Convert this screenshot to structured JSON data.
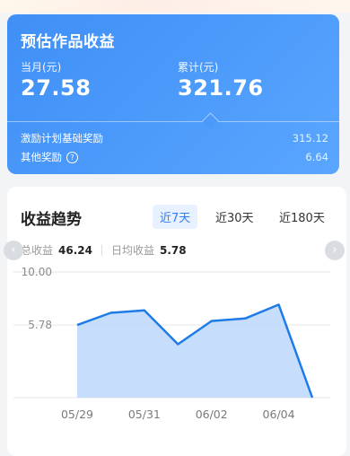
{
  "earnings_card": {
    "title": "预估作品收益",
    "current_month_label": "当月(元)",
    "current_month_value": "27.58",
    "cumulative_label": "累计(元)",
    "cumulative_value": "321.76",
    "rows": [
      {
        "label": "激励计划基础奖励",
        "value": "315.12"
      },
      {
        "label": "其他奖励",
        "value": "6.64",
        "help_icon": "?"
      }
    ]
  },
  "trend_card": {
    "title": "收益趋势",
    "tabs": [
      "近7天",
      "近30天",
      "近180天"
    ],
    "active_tab": 0,
    "total_label": "总收益",
    "total_value": "46.24",
    "daily_avg_label": "日均收益",
    "daily_avg_value": "5.78",
    "prev_icon": "chevron-left-icon",
    "next_icon": "chevron-right-icon"
  },
  "chart_data": {
    "type": "area",
    "x": [
      "05/29",
      "05/30",
      "05/31",
      "06/01",
      "06/02",
      "06/03",
      "06/04",
      "06/05"
    ],
    "xtick_labels": [
      "05/29",
      "05/31",
      "06/02",
      "06/04"
    ],
    "series": [
      {
        "values": [
          5.78,
          6.75,
          6.95,
          4.25,
          6.1,
          6.3,
          7.4,
          0.0
        ]
      }
    ],
    "ytick_labels": [
      "10.00",
      "5.78"
    ],
    "ylim": [
      0,
      10
    ],
    "grid": true,
    "colors": {
      "line": "#1f7be8",
      "fill": "#bcd8fb"
    }
  }
}
